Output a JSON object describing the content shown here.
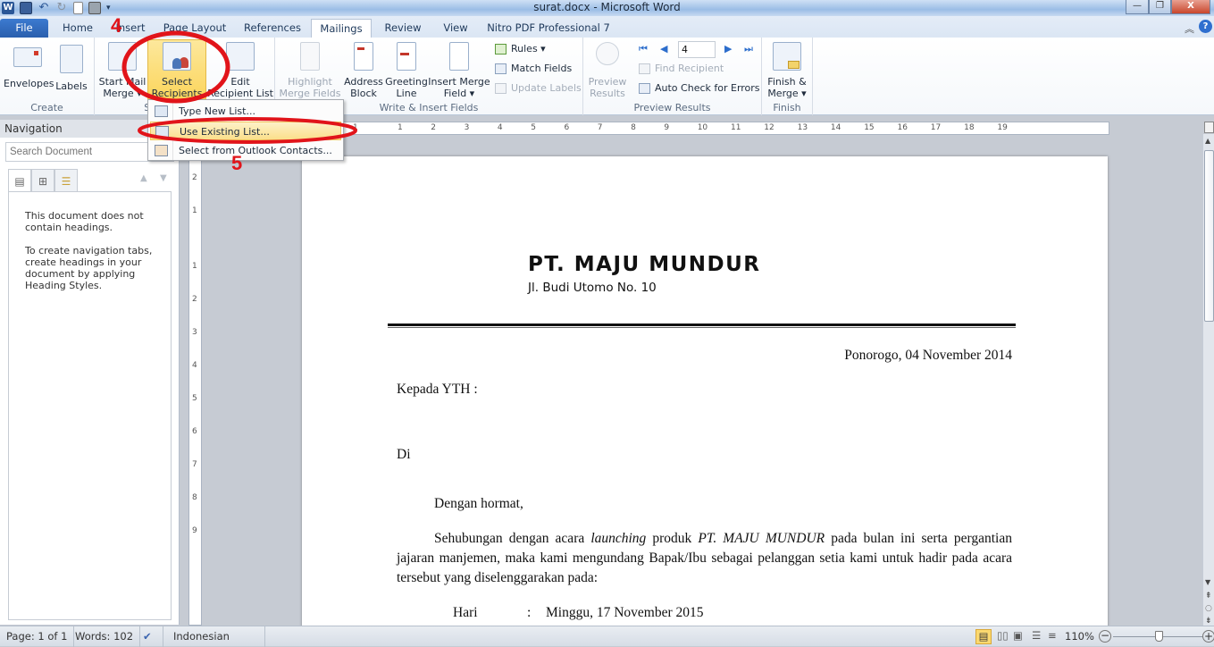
{
  "window": {
    "title": "surat.docx - Microsoft Word",
    "app_icon": "word-logo-icon",
    "quick_access": [
      "save-icon",
      "undo-icon",
      "redo-icon",
      "new-document-icon",
      "print-preview-icon",
      "customize-qat-icon"
    ],
    "controls": {
      "minimize": "—",
      "restore": "❐",
      "close": "X"
    }
  },
  "ribbon_tabs": [
    {
      "label": "File"
    },
    {
      "label": "Home"
    },
    {
      "label": "Insert"
    },
    {
      "label": "Page Layout"
    },
    {
      "label": "References"
    },
    {
      "label": "Mailings",
      "active": true
    },
    {
      "label": "Review"
    },
    {
      "label": "View"
    },
    {
      "label": "Nitro PDF Professional 7"
    }
  ],
  "ribbon": {
    "groups": {
      "create": {
        "label": "Create",
        "envelopes": "Envelopes",
        "labels": "Labels"
      },
      "start_mail_merge": {
        "label": "Start Mail Merge",
        "start_line1": "Start Mail",
        "start_line2": "Merge ▾",
        "select_line1": "Select",
        "select_line2": "Recipients ▾",
        "edit_line1": "Edit",
        "edit_line2": "Recipient List"
      },
      "write_insert": {
        "label": "Write & Insert Fields",
        "highlight_line1": "Highlight",
        "highlight_line2": "Merge Fields",
        "address_line1": "Address",
        "address_line2": "Block",
        "greeting_line1": "Greeting",
        "greeting_line2": "Line",
        "insert_line1": "Insert Merge",
        "insert_line2": "Field ▾",
        "rules": "Rules ▾",
        "match_fields": "Match Fields",
        "update_labels": "Update Labels"
      },
      "preview": {
        "label": "Preview Results",
        "preview_line1": "Preview",
        "preview_line2": "Results",
        "record_value": "4",
        "find_recipient": "Find Recipient",
        "auto_check": "Auto Check for Errors"
      },
      "finish": {
        "label": "Finish",
        "finish_line1": "Finish &",
        "finish_line2": "Merge ▾"
      }
    }
  },
  "dropdown_menu": {
    "items": [
      {
        "label": "Type New List...",
        "icon": "new-list-icon"
      },
      {
        "label": "Use Existing List...",
        "icon": "existing-list-icon",
        "highlighted": true
      },
      {
        "label": "Select from Outlook Contacts...",
        "icon": "outlook-contacts-icon"
      }
    ]
  },
  "annotations": {
    "step4": "4",
    "step5": "5",
    "color": "#e1141a"
  },
  "navigation_pane": {
    "title": "Navigation",
    "search_placeholder": "Search Document",
    "message1": "This document does not contain headings.",
    "message2": "To create navigation tabs, create headings in your document by applying Heading Styles."
  },
  "ruler": {
    "h_ticks": [
      "1",
      "1",
      "2",
      "3",
      "4",
      "5",
      "6",
      "7",
      "8",
      "9",
      "10",
      "11",
      "12",
      "13",
      "14",
      "15",
      "16",
      "17",
      "18",
      "19"
    ],
    "v_ticks": [
      "2",
      "1",
      "1",
      "2",
      "3",
      "4",
      "5",
      "6",
      "7",
      "8",
      "9"
    ]
  },
  "document": {
    "company": "PT. MAJU MUNDUR",
    "address": "Jl. Budi Utomo No. 10",
    "date": "Ponorogo, 04 November 2014",
    "to": "Kepada YTH :",
    "di": "Di",
    "greeting": "Dengan hormat,",
    "para_a": "Sehubungan dengan acara ",
    "para_italic1": "launching",
    "para_b": " produk ",
    "para_italic2": "PT. MAJU MUNDUR",
    "para_c": " pada bulan ini serta pergantian jajaran manjemen, maka kami mengundang Bapak/Ibu sebagai pelanggan setia kami untuk hadir pada acara tersebut yang diselenggarakan pada:",
    "hari_label": "Hari",
    "hari_sep": ":",
    "hari_value": "Minggu, 17 November 2015"
  },
  "status_bar": {
    "page": "Page: 1 of 1",
    "words": "Words: 102",
    "language": "Indonesian",
    "zoom": "110%",
    "zoom_level_percent": 110
  }
}
